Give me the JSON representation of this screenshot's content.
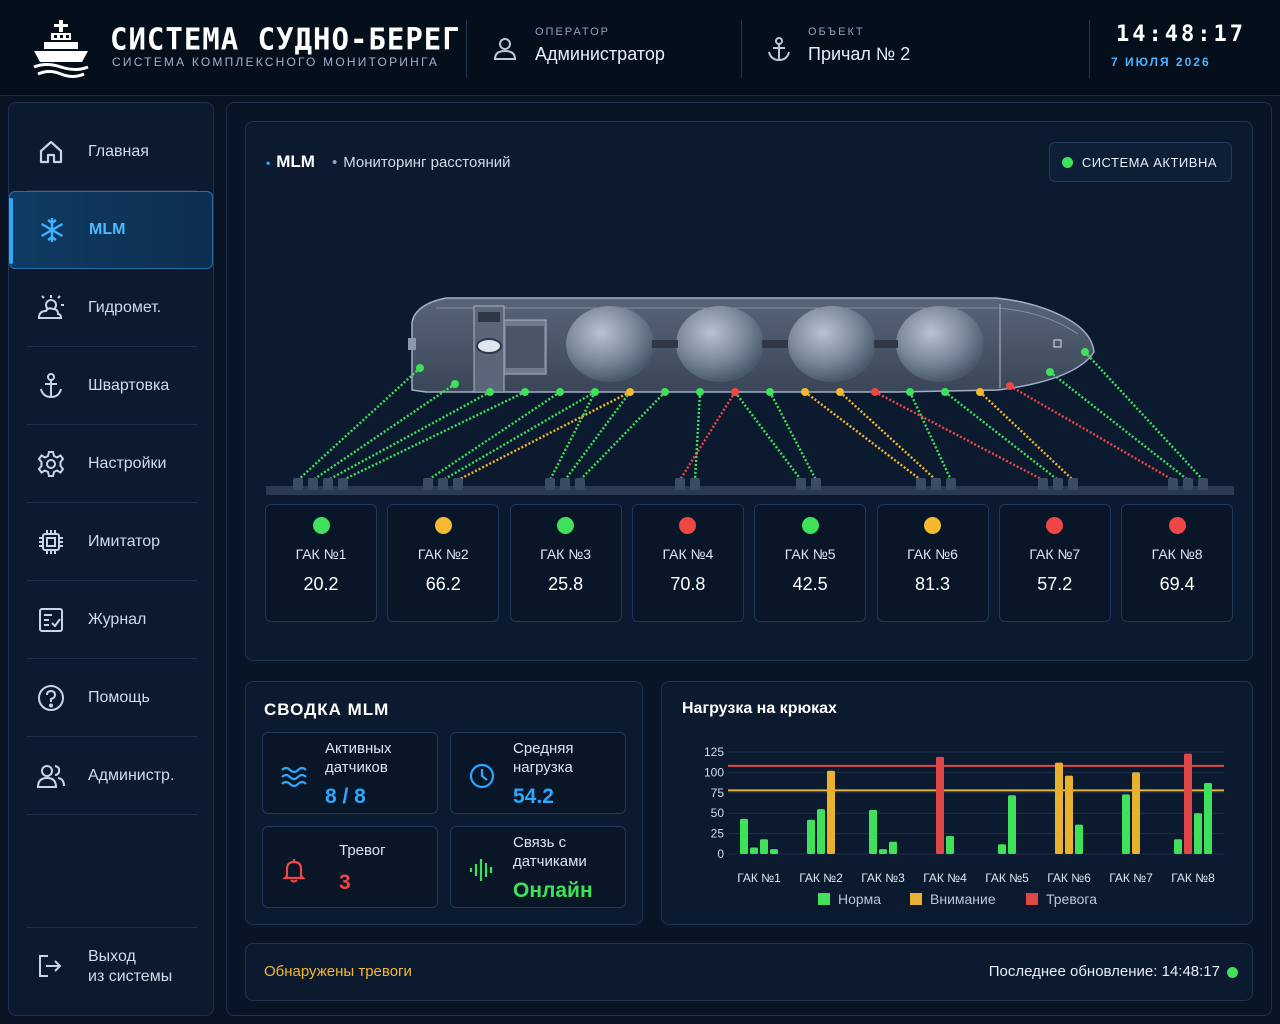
{
  "header": {
    "title": "СИСТЕМА СУДНО-БЕРЕГ",
    "subtitle": "СИСТЕМА КОМПЛЕКСНОГО МОНИТОРИНГА",
    "operator_caption": "ОПЕРАТОР",
    "operator_value": "Администратор",
    "object_caption": "ОБЪЕКТ",
    "object_value": "Причал № 2",
    "time": "14:48:17",
    "date": "7 ИЮЛЯ 2026"
  },
  "sidebar": {
    "items": [
      {
        "label": "Главная",
        "icon": "home-icon"
      },
      {
        "label": "MLM",
        "icon": "snowflake-icon",
        "active": true
      },
      {
        "label": "Гидромет.",
        "icon": "weather-icon"
      },
      {
        "label": "Швартовка",
        "icon": "anchor-icon"
      },
      {
        "label": "Настройки",
        "icon": "gear-icon"
      },
      {
        "label": "Имитатор",
        "icon": "chip-icon"
      },
      {
        "label": "Журнал",
        "icon": "journal-icon"
      },
      {
        "label": "Помощь",
        "icon": "help-icon"
      },
      {
        "label": "Администр.",
        "icon": "users-icon"
      }
    ],
    "logout_line1": "Выход",
    "logout_line2": "из системы"
  },
  "mlm": {
    "title": "MLM",
    "subtitle": "Мониторинг расстояний",
    "system_status": "СИСТЕМА АКТИВНА",
    "hooks": [
      {
        "name": "ГАК №1",
        "value": "20.2",
        "status": "ok"
      },
      {
        "name": "ГАК №2",
        "value": "66.2",
        "status": "warn"
      },
      {
        "name": "ГАК №3",
        "value": "25.8",
        "status": "ok"
      },
      {
        "name": "ГАК №4",
        "value": "70.8",
        "status": "alarm"
      },
      {
        "name": "ГАК №5",
        "value": "42.5",
        "status": "ok"
      },
      {
        "name": "ГАК №6",
        "value": "81.3",
        "status": "warn"
      },
      {
        "name": "ГАК №7",
        "value": "57.2",
        "status": "alarm"
      },
      {
        "name": "ГАК №8",
        "value": "69.4",
        "status": "alarm"
      }
    ]
  },
  "summary": {
    "title": "СВОДКА MLM",
    "active_sensors_label_1": "Активных",
    "active_sensors_label_2": "датчиков",
    "active_sensors_value": "8 / 8",
    "avg_load_label_1": "Средняя",
    "avg_load_label_2": "нагрузка",
    "avg_load_value": "54.2",
    "alarms_label": "Тревог",
    "alarms_value": "3",
    "link_label_1": "Связь с",
    "link_label_2": "датчиками",
    "link_value": "Онлайн"
  },
  "chart_data": {
    "type": "bar",
    "title": "Нагрузка на крюках",
    "categories": [
      "ГАК №1",
      "ГАК №2",
      "ГАК №3",
      "ГАК №4",
      "ГАК №5",
      "ГАК №6",
      "ГАК №7",
      "ГАК №8"
    ],
    "yticks": [
      0,
      25,
      50,
      75,
      100,
      125
    ],
    "ylim": [
      0,
      125
    ],
    "thresholds": [
      {
        "value": 108,
        "color": "#e04848"
      },
      {
        "value": 78,
        "color": "#e8b22e"
      }
    ],
    "legend": [
      {
        "label": "Норма",
        "color": "#3fe05a"
      },
      {
        "label": "Внимание",
        "color": "#e8b22e"
      },
      {
        "label": "Тревога",
        "color": "#e04848"
      }
    ],
    "groups": [
      {
        "category": "ГАК №1",
        "bars": [
          {
            "value": 43,
            "status": "ok"
          },
          {
            "value": 8,
            "status": "ok"
          },
          {
            "value": 18,
            "status": "ok"
          },
          {
            "value": 6,
            "status": "ok"
          }
        ]
      },
      {
        "category": "ГАК №2",
        "bars": [
          {
            "value": 42,
            "status": "ok"
          },
          {
            "value": 55,
            "status": "ok"
          },
          {
            "value": 102,
            "status": "warn"
          }
        ]
      },
      {
        "category": "ГАК №3",
        "bars": [
          {
            "value": 54,
            "status": "ok"
          },
          {
            "value": 6,
            "status": "ok"
          },
          {
            "value": 15,
            "status": "ok"
          }
        ]
      },
      {
        "category": "ГАК №4",
        "bars": [
          {
            "value": 119,
            "status": "alarm"
          },
          {
            "value": 22,
            "status": "ok"
          }
        ]
      },
      {
        "category": "ГАК №5",
        "bars": [
          {
            "value": 12,
            "status": "ok"
          },
          {
            "value": 72,
            "status": "ok"
          }
        ]
      },
      {
        "category": "ГАК №6",
        "bars": [
          {
            "value": 112,
            "status": "warn"
          },
          {
            "value": 96,
            "status": "warn"
          },
          {
            "value": 36,
            "status": "ok"
          }
        ]
      },
      {
        "category": "ГАК №7",
        "bars": [
          {
            "value": 73,
            "status": "ok"
          },
          {
            "value": 100,
            "status": "warn"
          }
        ]
      },
      {
        "category": "ГАК №8",
        "bars": [
          {
            "value": 18,
            "status": "ok"
          },
          {
            "value": 123,
            "status": "alarm"
          },
          {
            "value": 50,
            "status": "ok"
          },
          {
            "value": 87,
            "status": "ok"
          }
        ]
      }
    ]
  },
  "status_bar": {
    "alarm_text": "Обнаружены тревоги",
    "update_text": "Последнее обновление: 14:48:17"
  },
  "colors": {
    "ok": "#3fe05a",
    "warn": "#f5b82e",
    "alarm": "#f04646",
    "accent": "#2ea7ff"
  }
}
